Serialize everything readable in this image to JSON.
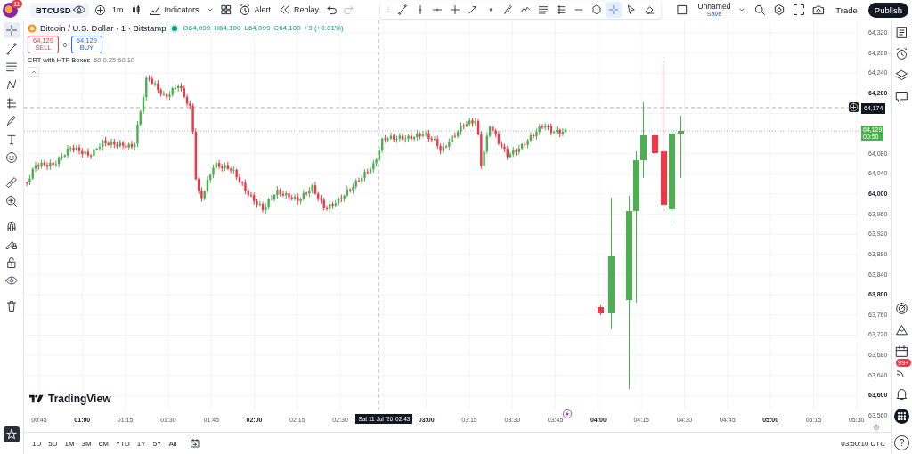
{
  "header": {
    "notification_count": "11",
    "symbol": "BTCUSD",
    "interval": "1m",
    "buttons": [
      {
        "kind": "indicators",
        "label": "Indicators"
      },
      {
        "kind": "alert",
        "label": "Alert"
      },
      {
        "kind": "replay",
        "label": "Replay"
      }
    ],
    "layout_name": "Unnamed",
    "layout_status": "Save",
    "trade": "Trade",
    "publish": "Publish"
  },
  "drawing_toolbar": [
    {
      "kind": "line",
      "selected": false
    },
    {
      "kind": "vline",
      "selected": false
    },
    {
      "kind": "hray",
      "selected": false
    },
    {
      "kind": "cross",
      "selected": false
    },
    {
      "kind": "arrow",
      "selected": false
    },
    {
      "kind": "dot",
      "selected": false
    },
    {
      "kind": "brush",
      "selected": false
    },
    {
      "kind": "path",
      "selected": false
    },
    {
      "kind": "fib",
      "selected": false
    },
    {
      "kind": "fib2",
      "selected": false
    },
    {
      "kind": "hline",
      "selected": false
    },
    {
      "kind": "polygon",
      "selected": false
    },
    {
      "kind": "crosshair",
      "selected": true
    },
    {
      "kind": "cursor",
      "selected": false
    },
    {
      "kind": "eraser",
      "selected": false
    }
  ],
  "left_toolbar": {
    "groups": [
      {
        "tools": [
          {
            "kind": "crosshair",
            "selected": true
          },
          {
            "kind": "line",
            "selected": false
          },
          {
            "kind": "fib",
            "selected": false
          },
          {
            "kind": "pattern",
            "selected": false
          },
          {
            "kind": "projection",
            "selected": false
          },
          {
            "kind": "brush",
            "selected": false
          },
          {
            "kind": "text",
            "selected": false
          },
          {
            "kind": "emoji",
            "selected": false
          }
        ]
      },
      {
        "tools": [
          {
            "kind": "ruler",
            "selected": false
          },
          {
            "kind": "zoom",
            "selected": false
          }
        ]
      },
      {
        "tools": [
          {
            "kind": "magnet",
            "selected": false
          },
          {
            "kind": "lockdraw",
            "selected": false
          },
          {
            "kind": "lock",
            "selected": false
          },
          {
            "kind": "eye",
            "selected": false
          }
        ]
      },
      {
        "tools": [
          {
            "kind": "trash",
            "selected": false
          }
        ]
      }
    ]
  },
  "legend": {
    "title": "Bitcoin / U.S. Dollar · 1 · Bitstamp",
    "ohlc": [
      {
        "label": "O",
        "value": "64,099"
      },
      {
        "label": "H",
        "value": "64,100"
      },
      {
        "label": "L",
        "value": "64,099"
      },
      {
        "label": "C",
        "value": "64,100"
      }
    ],
    "change": "+9 (+0.01%)",
    "sell": {
      "price": "64,129",
      "label": "SELL"
    },
    "spread": "0",
    "buy": {
      "price": "64,129",
      "label": "BUY"
    },
    "indicator": {
      "name": "CRT with HTF Boxes",
      "params": "60 0.25 60 10"
    }
  },
  "price_axis": [
    {
      "kind": "tick",
      "label": "64,320",
      "major": false
    },
    {
      "kind": "tick",
      "label": "64,280",
      "major": false
    },
    {
      "kind": "tick",
      "label": "64,240",
      "major": false
    },
    {
      "kind": "tick",
      "label": "64,200",
      "major": true
    },
    {
      "kind": "crosshair",
      "label": "64,174"
    },
    {
      "kind": "last",
      "label": "64,129",
      "countdown": "00:50"
    },
    {
      "kind": "tick",
      "label": "64,080",
      "major": false
    },
    {
      "kind": "tick",
      "label": "64,040",
      "major": false
    },
    {
      "kind": "tick",
      "label": "64,000",
      "major": true
    },
    {
      "kind": "tick",
      "label": "63,960",
      "major": false
    },
    {
      "kind": "tick",
      "label": "63,920",
      "major": false
    },
    {
      "kind": "tick",
      "label": "63,880",
      "major": false
    },
    {
      "kind": "tick",
      "label": "63,840",
      "major": false
    },
    {
      "kind": "tick",
      "label": "63,800",
      "major": true
    },
    {
      "kind": "tick",
      "label": "63,760",
      "major": false
    },
    {
      "kind": "tick",
      "label": "63,720",
      "major": false
    },
    {
      "kind": "tick",
      "label": "63,680",
      "major": false
    },
    {
      "kind": "tick",
      "label": "63,640",
      "major": false
    },
    {
      "kind": "tick",
      "label": "63,600",
      "major": true
    },
    {
      "kind": "tick",
      "label": "63,560",
      "major": false
    }
  ],
  "time_axis": [
    {
      "kind": "tick",
      "label": "00:45",
      "major": false
    },
    {
      "kind": "tick",
      "label": "01:00",
      "major": true
    },
    {
      "kind": "tick",
      "label": "01:15",
      "major": false
    },
    {
      "kind": "tick",
      "label": "01:30",
      "major": false
    },
    {
      "kind": "tick",
      "label": "01:45",
      "major": false
    },
    {
      "kind": "tick",
      "label": "02:00",
      "major": true
    },
    {
      "kind": "tick",
      "label": "02:15",
      "major": false
    },
    {
      "kind": "tick",
      "label": "02:30",
      "major": false
    },
    {
      "kind": "crosshair",
      "date": "Sat 11 Jul '26",
      "time": "02:43"
    },
    {
      "kind": "tick",
      "label": "03:00",
      "major": true
    },
    {
      "kind": "tick",
      "label": "03:15",
      "major": false
    },
    {
      "kind": "tick",
      "label": "03:30",
      "major": false
    },
    {
      "kind": "tick",
      "label": "03:45",
      "major": false
    },
    {
      "kind": "tick",
      "label": "04:00",
      "major": true
    },
    {
      "kind": "tick",
      "label": "04:15",
      "major": false
    },
    {
      "kind": "tick",
      "label": "04:30",
      "major": false
    },
    {
      "kind": "tick",
      "label": "04:45",
      "major": false
    },
    {
      "kind": "tick",
      "label": "05:00",
      "major": true
    },
    {
      "kind": "tick",
      "label": "05:15",
      "major": false
    },
    {
      "kind": "tick",
      "label": "05:30",
      "major": false
    }
  ],
  "brand": "TradingView",
  "ranges": [
    "1D",
    "5D",
    "1M",
    "3M",
    "6M",
    "YTD",
    "1Y",
    "5Y",
    "All"
  ],
  "clock": "03:50:10 UTC",
  "right_sidebar": {
    "feed_badge": "99+",
    "help": "?"
  }
}
